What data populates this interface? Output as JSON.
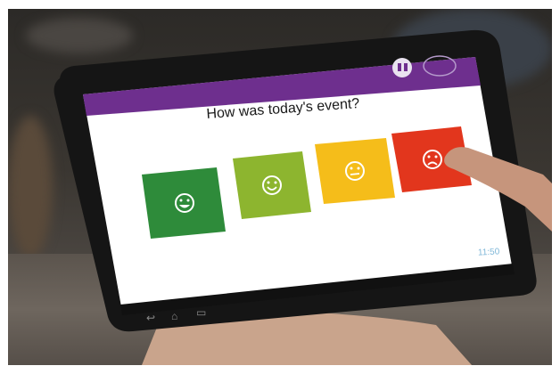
{
  "survey": {
    "question": "How was today's event?",
    "options": [
      {
        "face": "very-happy",
        "color": "#2e8b3a"
      },
      {
        "face": "happy",
        "color": "#8db52f"
      },
      {
        "face": "neutral",
        "color": "#f5bd1a"
      },
      {
        "face": "sad",
        "color": "#e2361d"
      }
    ]
  },
  "status_bar": {
    "time": "11:50"
  },
  "colors": {
    "header": "#6e2f8e",
    "screen": "#ffffff"
  }
}
